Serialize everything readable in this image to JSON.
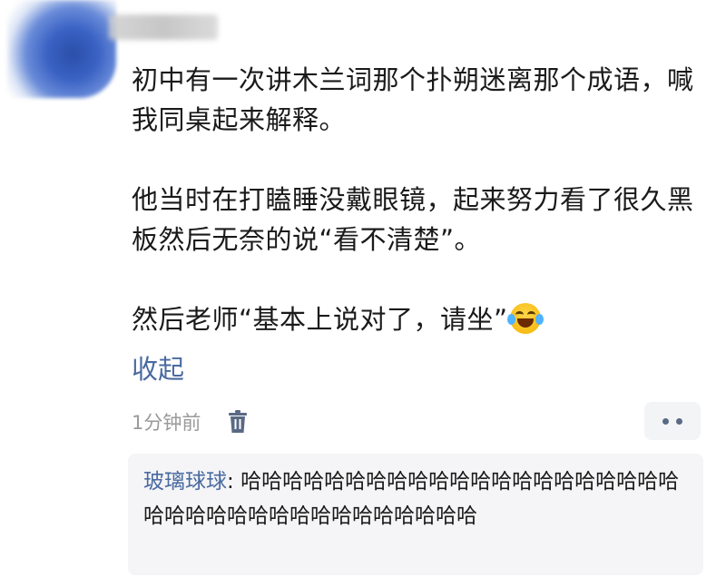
{
  "comment": {
    "paragraphs": [
      "初中有一次讲木兰词那个扑朔迷离那个成语，喊我同桌起来解释。",
      "他当时在打瞌睡没戴眼镜，起来努力看了很久黑板然后无奈的说“看不清楚”。",
      "然后老师“基本上说对了，请坐”"
    ],
    "emoji": "tears-of-joy-emoji"
  },
  "actions": {
    "collapse_label": "收起",
    "delete_icon": "trash-icon",
    "more_icon": "more-dots-icon"
  },
  "meta": {
    "timestamp": "1分钟前"
  },
  "reply": {
    "user": "玻璃球球",
    "separator": ": ",
    "text": "哈哈哈哈哈哈哈哈哈哈哈哈哈哈哈哈哈哈哈哈哈哈哈哈哈哈哈哈哈哈哈哈哈哈哈哈哈"
  },
  "colors": {
    "link": "#4a6aa0",
    "meta": "#9a9a9a",
    "reply_bg": "#f5f5f7"
  }
}
